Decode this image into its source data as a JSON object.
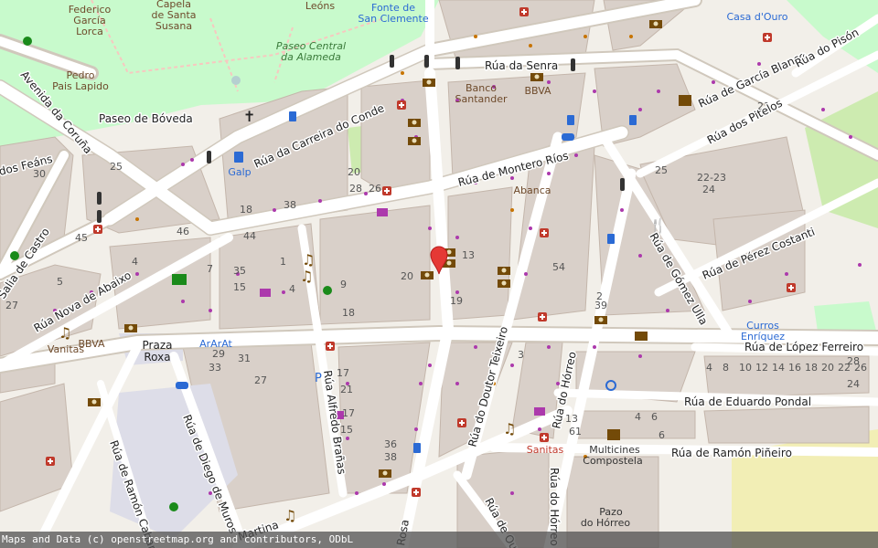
{
  "streets": {
    "senra": "Rúa da Senra",
    "garcia_blanco": "Rúa de García Blanco",
    "dos_pitelos": "Rúa dos Pitelos",
    "carreira_conde": "Rúa da Carreira do Conde",
    "paseo_bovedaneous": "Paseo de Bóveda",
    "montero_rios": "Rúa de Montero Ríos",
    "coruna": "Avenida da Coruña",
    "feans": "dos Feáns",
    "castro": "Salia de Castro",
    "nova_abaixo": "Rúa Nova de Abaixo",
    "perez_costanti": "Rúa de Pérez Costanti",
    "gomez_ulla": "Rúa de Gómez Ulla",
    "lopez_ferreiro": "Rúa de López Ferreiro",
    "eduardo_pondal": "Rúa de Eduardo Pondal",
    "ramon_pineiro": "Rúa de Ramón Piñeiro",
    "doutor_teixeiro": "Rúa do Doutor Teixeiro",
    "horreo": "Rúa do Hórreo",
    "horreo2": "Rúa do Hórreo",
    "alfredo_branas": "Rúa Alfredo Brañas",
    "diego_muros": "Rúa de Diego de Muros",
    "ramon_cabanillas": "Rúa de Ramón Cabani",
    "rosa": "Rosa",
    "ourense": "Rúa de Oure",
    "pison": "Rúa do Pisón",
    "martina": "Martina"
  },
  "places": {
    "federico": "Federico",
    "garcia": "García",
    "lorca": "Lorca",
    "capela": "Capela",
    "de_santa": "de Santa",
    "susana": "Susana",
    "leons": "Leóns",
    "fonte": "Fonte de",
    "san_clemente": "San Clemente",
    "paseo_central": "Paseo Central",
    "alameda": "da Alameda",
    "pedro": "Pedro",
    "pais_lapido": "Pais Lapido",
    "banco": "Banco",
    "santander": "Santander",
    "bbva1": "BBVA",
    "bbva2": "BBVA",
    "galp": "Galp",
    "abanca": "Abanca",
    "casa_ouro": "Casa d'Ouro",
    "currosenriquez1": "Curros",
    "currosenriquez2": "Enríquez",
    "praza_roxa1": "Praza",
    "praza_roxa2": "Roxa",
    "vanitas": "Vanitas",
    "ararat": "ArArAt",
    "sanitas": "Sanitas",
    "multicines1": "Multicines",
    "multicines2": "Compostela",
    "pazo1": "Pazo",
    "pazo2": "do Hórreo",
    "parking": "P",
    "parking2": "P"
  },
  "house_numbers": [
    "20",
    "18",
    "26",
    "13",
    "38",
    "28",
    "46",
    "44",
    "35",
    "15",
    "1",
    "4",
    "9",
    "20",
    "18",
    "17",
    "21",
    "19",
    "33",
    "27",
    "29",
    "31",
    "17",
    "15",
    "36",
    "38",
    "6",
    "13",
    "2",
    "3",
    "54",
    "39",
    "25",
    "22-23",
    "24",
    "21",
    "61",
    "4",
    "6",
    "4",
    "8",
    "10",
    "12",
    "14",
    "16",
    "18",
    "20",
    "22",
    "24",
    "26",
    "28",
    "30",
    "25",
    "27",
    "45",
    "4",
    "5",
    "7",
    "35"
  ],
  "colors": {
    "background": "#f2efe9",
    "building": "#d9d0c9",
    "park": "#c8facc",
    "road": "#ffffff",
    "road_casing": "#d8d0c4",
    "pedestrian": "#dddde8",
    "shop_dot": "#ac39ac",
    "amenity_dot": "#c77400",
    "pin": "#e53935"
  },
  "marker": {
    "name": "location-pin"
  },
  "attribution": "Maps and Data (c) openstreetmap.org and contributors, ODbL"
}
